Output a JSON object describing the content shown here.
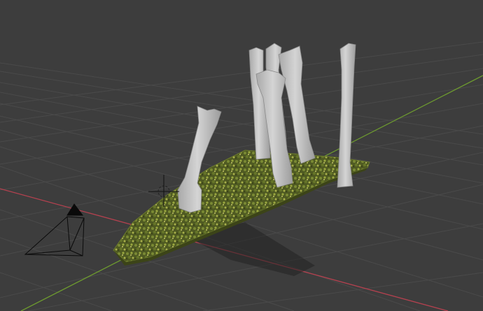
{
  "viewport": {
    "editor": "3D Viewport",
    "colors": {
      "background": "#3d3d3d",
      "grid_line": "#4a4a4a",
      "x_axis": "#b4414f",
      "y_axis": "#6d9a2f",
      "trunk": "#c9c9c9",
      "trunk_shade": "#9a9a9a",
      "ground_cover": "#5f6a28",
      "camera": "#0a0a0a"
    },
    "objects": [
      {
        "name": "tree-trunk"
      },
      {
        "name": "tree-trunk"
      },
      {
        "name": "tree-trunk"
      },
      {
        "name": "tree-trunk"
      },
      {
        "name": "tree-trunk"
      },
      {
        "name": "tree-trunk"
      },
      {
        "name": "ground-cover"
      },
      {
        "name": "camera"
      },
      {
        "name": "3d-cursor"
      }
    ]
  }
}
